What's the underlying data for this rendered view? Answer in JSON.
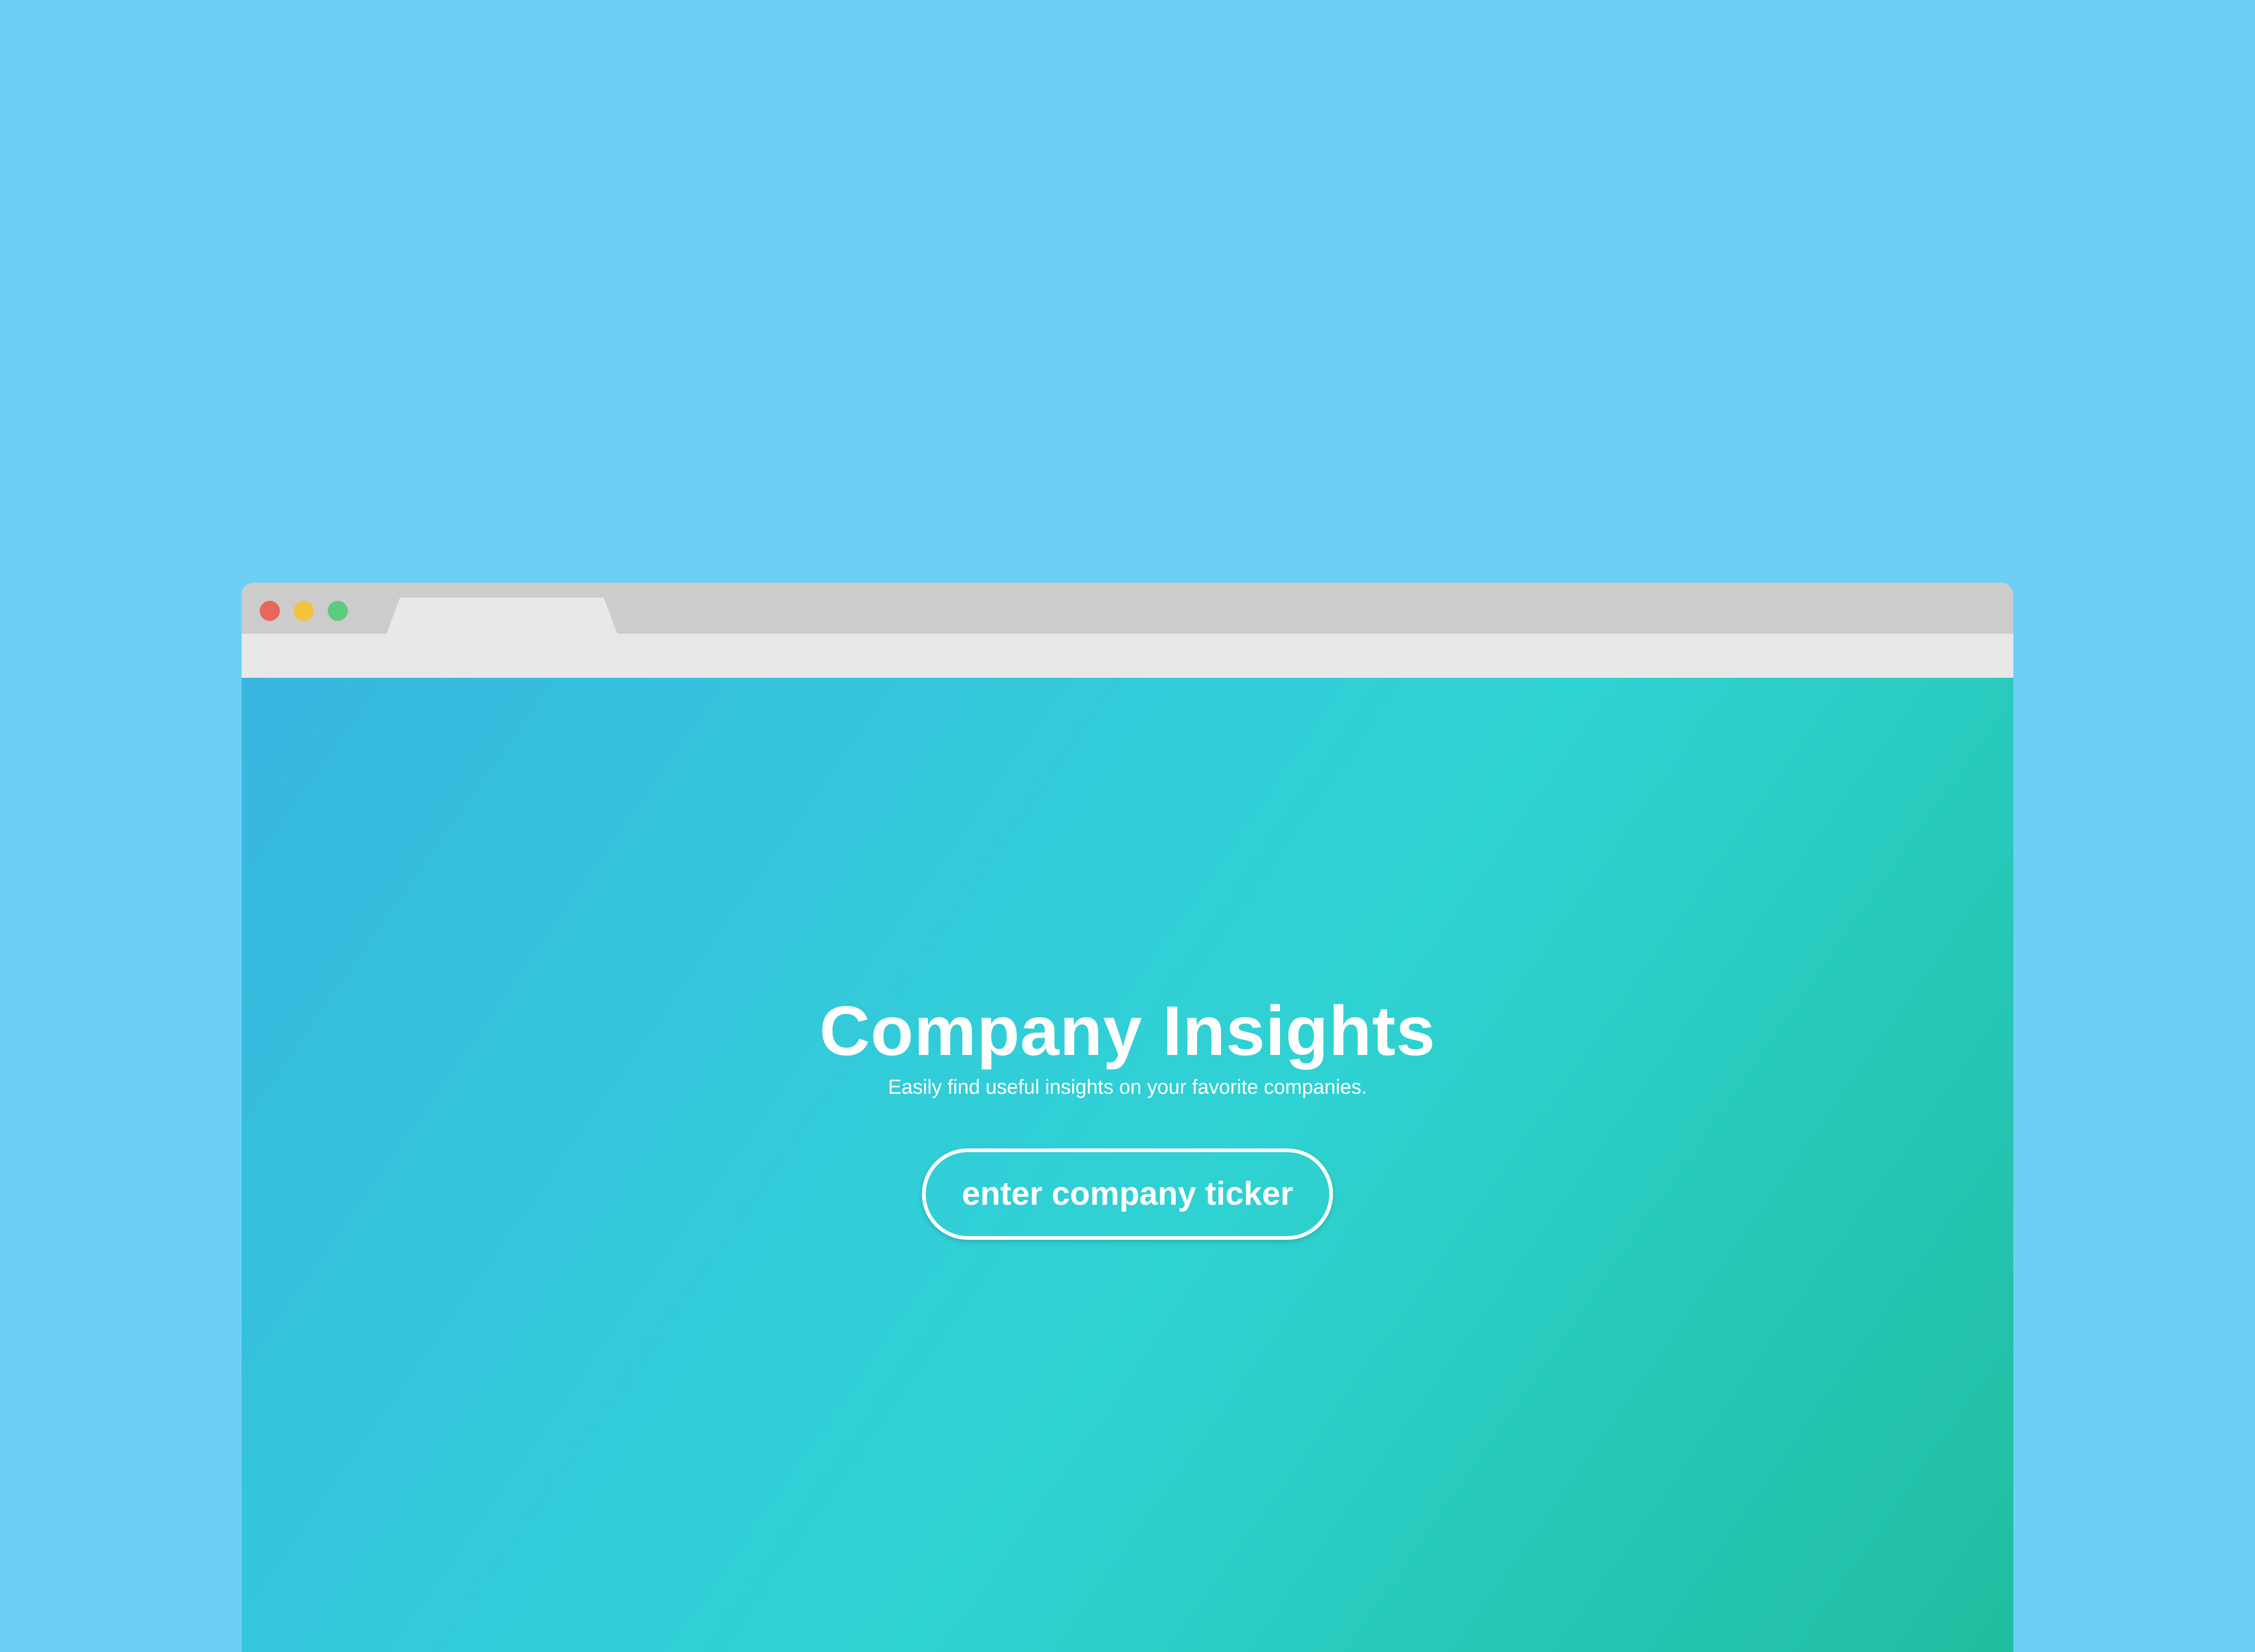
{
  "colors": {
    "backdrop": "#6ecff5",
    "titlebar": "#cccccc",
    "toolbar": "#e8e8e8",
    "close": "#e8665b",
    "minimize": "#f2c43c",
    "maximize": "#5ecb7e",
    "gradient_start": "#38b6e0",
    "gradient_end": "#20bd9f",
    "text": "#ffffff"
  },
  "window_controls": [
    {
      "name": "close",
      "icon": "close-dot-icon"
    },
    {
      "name": "minimize",
      "icon": "minimize-dot-icon"
    },
    {
      "name": "maximize",
      "icon": "maximize-dot-icon"
    }
  ],
  "hero": {
    "title": "Company Insights",
    "subtitle": "Easily find useful insights on your favorite companies.",
    "button_label": "enter company ticker"
  }
}
